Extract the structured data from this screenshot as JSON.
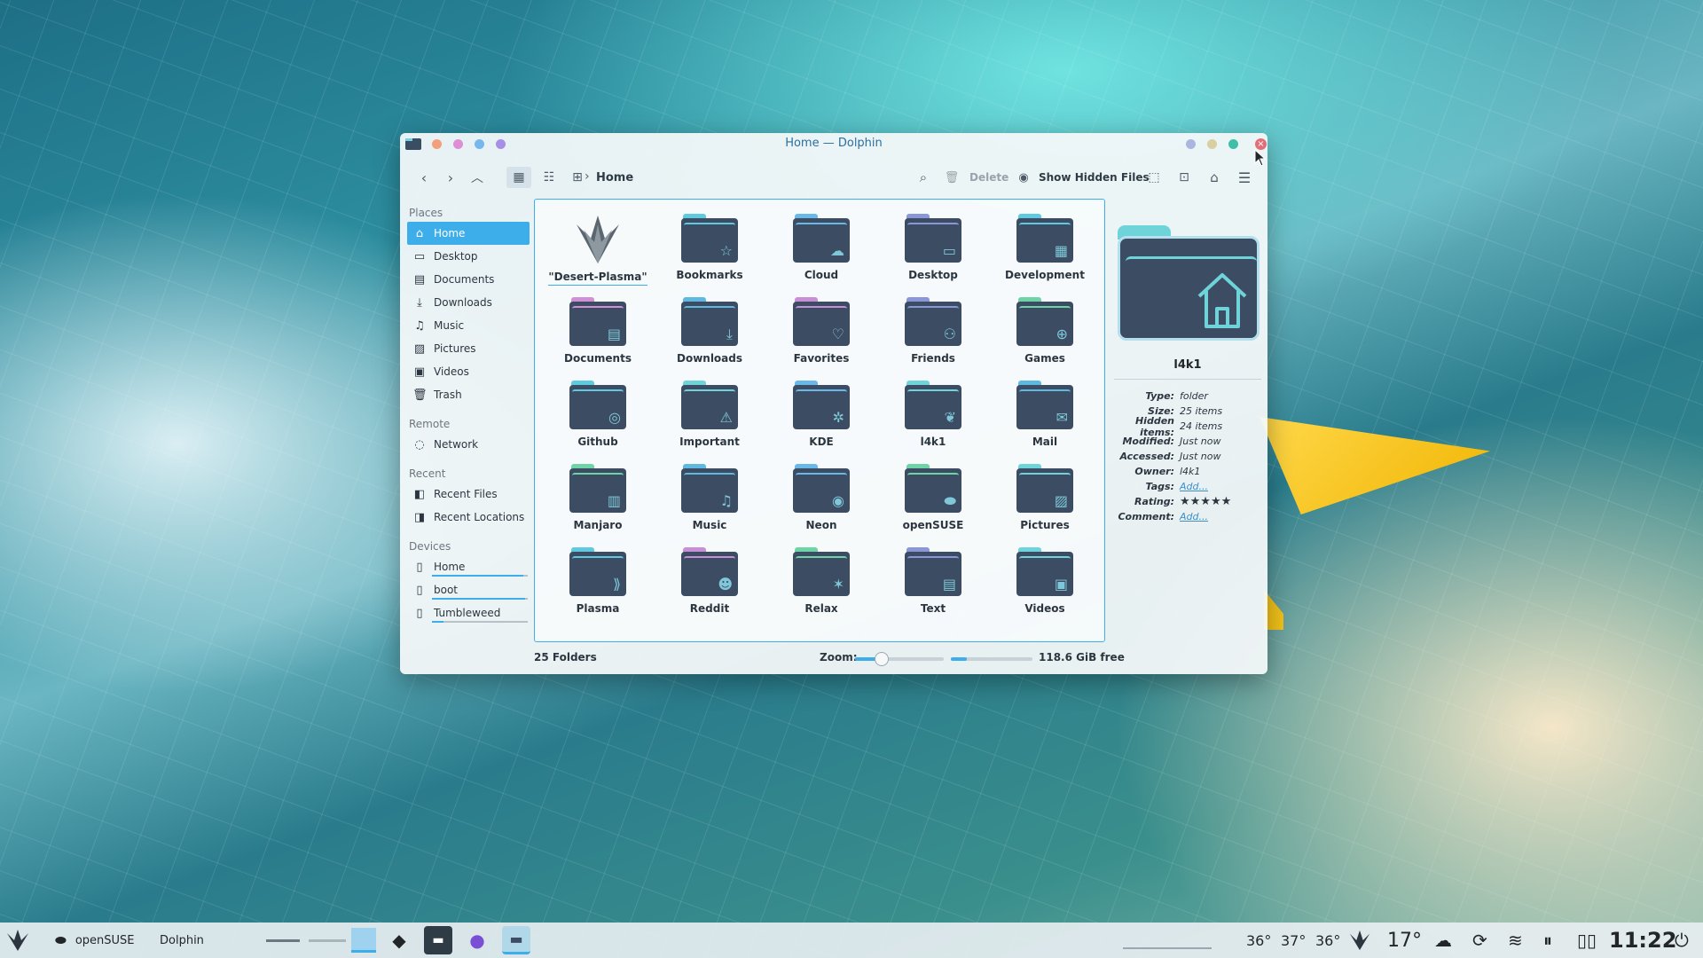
{
  "window": {
    "title": "Home — Dolphin"
  },
  "toolbar": {
    "breadcrumb": "Home",
    "delete_label": "Delete",
    "show_hidden_label": "Show Hidden Files"
  },
  "sidebar": {
    "sections": [
      {
        "title": "Places",
        "items": [
          {
            "label": "Home",
            "icon": "home-icon"
          },
          {
            "label": "Desktop",
            "icon": "desktop-icon"
          },
          {
            "label": "Documents",
            "icon": "documents-icon"
          },
          {
            "label": "Downloads",
            "icon": "download-icon"
          },
          {
            "label": "Music",
            "icon": "music-icon"
          },
          {
            "label": "Pictures",
            "icon": "pictures-icon"
          },
          {
            "label": "Videos",
            "icon": "videos-icon"
          },
          {
            "label": "Trash",
            "icon": "trash-icon"
          }
        ]
      },
      {
        "title": "Remote",
        "items": [
          {
            "label": "Network",
            "icon": "network-icon"
          }
        ]
      },
      {
        "title": "Recent",
        "items": [
          {
            "label": "Recent Files",
            "icon": "recent-files-icon"
          },
          {
            "label": "Recent Locations",
            "icon": "recent-locations-icon"
          }
        ]
      },
      {
        "title": "Devices",
        "items": [
          {
            "label": "Home",
            "icon": "drive-icon",
            "usage": 0.95
          },
          {
            "label": "boot",
            "icon": "drive-icon",
            "usage": 0.97
          },
          {
            "label": "Tumbleweed",
            "icon": "drive-icon",
            "usage": 0.12
          }
        ]
      }
    ]
  },
  "files": [
    {
      "label": "\"Desert-Plasma\"",
      "icon": "desert-plasma-logo-icon",
      "accent": "#9aa3ab"
    },
    {
      "label": "Bookmarks",
      "icon": "bookmark-icon",
      "accent": "#5fc9e0"
    },
    {
      "label": "Cloud",
      "icon": "cloud-icon",
      "accent": "#6ab8e8"
    },
    {
      "label": "Desktop",
      "icon": "desktop-icon",
      "accent": "#8b96d8"
    },
    {
      "label": "Development",
      "icon": "development-icon",
      "accent": "#5fc9e0"
    },
    {
      "label": "Documents",
      "icon": "documents-icon",
      "accent": "#d38fd6"
    },
    {
      "label": "Downloads",
      "icon": "download-icon",
      "accent": "#5fb8e0"
    },
    {
      "label": "Favorites",
      "icon": "heart-icon",
      "accent": "#c98fd6"
    },
    {
      "label": "Friends",
      "icon": "friends-icon",
      "accent": "#8b96d8"
    },
    {
      "label": "Games",
      "icon": "gamepad-icon",
      "accent": "#6fd3a8"
    },
    {
      "label": "Github",
      "icon": "github-icon",
      "accent": "#5fc9e0"
    },
    {
      "label": "Important",
      "icon": "warning-icon",
      "accent": "#6fd3da"
    },
    {
      "label": "KDE",
      "icon": "kde-icon",
      "accent": "#6ab8e8"
    },
    {
      "label": "l4k1",
      "icon": "chameleon-icon",
      "accent": "#6fd3da"
    },
    {
      "label": "Mail",
      "icon": "mail-icon",
      "accent": "#5fb8e0"
    },
    {
      "label": "Manjaro",
      "icon": "manjaro-icon",
      "accent": "#6fd3a8"
    },
    {
      "label": "Music",
      "icon": "music-icon",
      "accent": "#5fb8e0"
    },
    {
      "label": "Neon",
      "icon": "neon-icon",
      "accent": "#6ab8e8"
    },
    {
      "label": "openSUSE",
      "icon": "opensuse-icon",
      "accent": "#6fd3a8"
    },
    {
      "label": "Pictures",
      "icon": "pictures-icon",
      "accent": "#6fd3da"
    },
    {
      "label": "Plasma",
      "icon": "plasma-icon",
      "accent": "#5fc9e0"
    },
    {
      "label": "Reddit",
      "icon": "reddit-icon",
      "accent": "#c98fd6"
    },
    {
      "label": "Relax",
      "icon": "cannabis-icon",
      "accent": "#6fd3a8"
    },
    {
      "label": "Text",
      "icon": "text-icon",
      "accent": "#8b96d8"
    },
    {
      "label": "Videos",
      "icon": "videos-icon",
      "accent": "#6fd3da"
    }
  ],
  "info_panel": {
    "name": "l4k1",
    "rows": [
      {
        "key": "Type:",
        "value": "folder"
      },
      {
        "key": "Size:",
        "value": "25 items"
      },
      {
        "key": "Hidden items:",
        "value": "24 items"
      },
      {
        "key": "Modified:",
        "value": "Just now"
      },
      {
        "key": "Accessed:",
        "value": "Just now"
      },
      {
        "key": "Owner:",
        "value": "l4k1"
      },
      {
        "key": "Tags:",
        "value": "Add...",
        "link": true
      },
      {
        "key": "Rating:",
        "value": "★★★★★",
        "rating": 5
      },
      {
        "key": "Comment:",
        "value": "Add...",
        "link": true
      }
    ]
  },
  "statusbar": {
    "count": "25 Folders",
    "zoom_label": "Zoom:",
    "zoom_level": 0.3,
    "disk_used_fraction": 0.2,
    "free_space": "118.6 GiB free"
  },
  "taskbar": {
    "launcher_icon": "desert-plasma-logo-icon",
    "window_label_1": "openSUSE",
    "window_label_2": "Dolphin",
    "temps": [
      "36°",
      "37°",
      "36°"
    ],
    "weather_temp": "17°",
    "clock": "11:22"
  },
  "colors": {
    "accent": "#3daee9",
    "folder_body": "#3c4d63",
    "close": "#e26f78"
  }
}
